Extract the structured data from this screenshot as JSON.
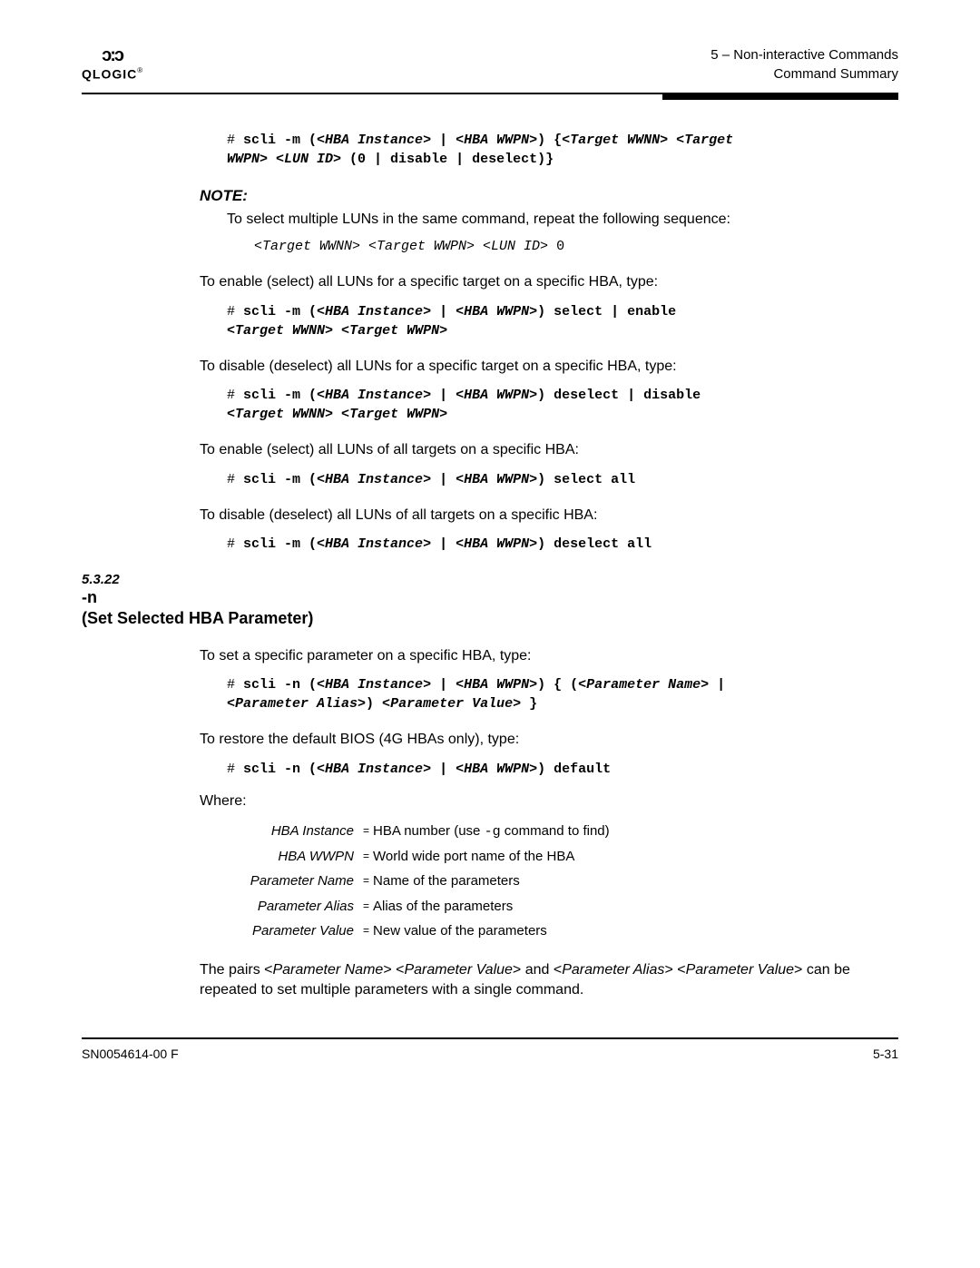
{
  "header": {
    "logo_text": "QLOGIC",
    "chapter": "5 – Non-interactive Commands",
    "section": "Command Summary"
  },
  "cmd1": {
    "line1a": "scli -m (<",
    "line1b": "HBA Instance",
    "line1c": "> | <",
    "line1d": "HBA WWPN",
    "line1e": ">) {<",
    "line1f": "Target WWNN",
    "line1g": "> <",
    "line1h": "Target",
    "line2a": "WWPN",
    "line2b": "> <",
    "line2c": "LUN ID",
    "line2d": "> (0 | disable | deselect)}"
  },
  "note": {
    "label": "NOTE:",
    "body": "To select multiple LUNs in the same command, repeat the following sequence:",
    "code": "<Target WWNN> <Target WWPN> <LUN ID>",
    "code_suffix": " 0"
  },
  "para1": "To enable (select) all LUNs for a specific target on a specific HBA, type:",
  "cmd2": {
    "a": "scli -m (<",
    "b": "HBA Instance",
    "c": "> | <",
    "d": "HBA WWPN",
    "e": ">) select | enable",
    "l2a": "<",
    "l2b": "Target WWNN",
    "l2c": "> <",
    "l2d": "Target WWPN",
    "l2e": ">"
  },
  "para2": "To disable (deselect) all LUNs for a specific target on a specific HBA, type:",
  "cmd3": {
    "a": "scli -m (<",
    "b": "HBA Instance",
    "c": "> | <",
    "d": "HBA WWPN",
    "e": ">) deselect | disable",
    "l2a": "<",
    "l2b": "Target WWNN",
    "l2c": "> <",
    "l2d": "Target WWPN",
    "l2e": ">"
  },
  "para3": "To enable (select) all LUNs of all targets on a specific HBA:",
  "cmd4": {
    "a": "scli -m (<",
    "b": "HBA Instance",
    "c": "> | <",
    "d": "HBA WWPN",
    "e": ">) select all"
  },
  "para4": "To disable (deselect) all LUNs of all targets on a specific HBA:",
  "cmd5": {
    "a": "scli -m (<",
    "b": "HBA Instance",
    "c": "> | <",
    "d": "HBA WWPN",
    "e": ">) deselect all"
  },
  "section": {
    "num": "5.3.22",
    "flag": "-n",
    "title": "(Set Selected HBA Parameter)"
  },
  "para5": "To set a specific parameter on a specific HBA, type:",
  "cmd6": {
    "a": "scli -n (<",
    "b": "HBA Instance",
    "c": "> | <",
    "d": "HBA WWPN",
    "e": ">) { (<",
    "f": "Parameter Name",
    "g": "> |",
    "l2a": "<",
    "l2b": "Parameter Alias",
    "l2c": ">) <",
    "l2d": "Parameter Value",
    "l2e": "> }"
  },
  "para6": "To restore the default BIOS (4G HBAs only), type:",
  "cmd7": {
    "a": "scli -n (<",
    "b": "HBA Instance",
    "c": "> | <",
    "d": "HBA WWPN",
    "e": ">) default"
  },
  "where": "Where:",
  "defs": [
    {
      "term": "HBA Instance",
      "desc_pre": "HBA number (use ",
      "desc_code": "-g",
      "desc_post": " command to find)"
    },
    {
      "term": "HBA WWPN",
      "desc_pre": "World wide port name of the HBA",
      "desc_code": "",
      "desc_post": ""
    },
    {
      "term": "Parameter Name",
      "desc_pre": "Name of the parameters",
      "desc_code": "",
      "desc_post": ""
    },
    {
      "term": "Parameter Alias",
      "desc_pre": "Alias of the parameters",
      "desc_code": "",
      "desc_post": ""
    },
    {
      "term": "Parameter Value",
      "desc_pre": "New value of the parameters",
      "desc_code": "",
      "desc_post": ""
    }
  ],
  "para7": {
    "t1": "The pairs <",
    "i1": "Parameter Name",
    "t2": "> <",
    "i2": "Parameter Value",
    "t3": "> and <",
    "i3": "Parameter Alias",
    "t4": "> <",
    "i4": "Parameter Value",
    "t5": "> can be repeated to set multiple parameters with a single command."
  },
  "footer": {
    "left": "SN0054614-00 F",
    "right": "5-31"
  }
}
